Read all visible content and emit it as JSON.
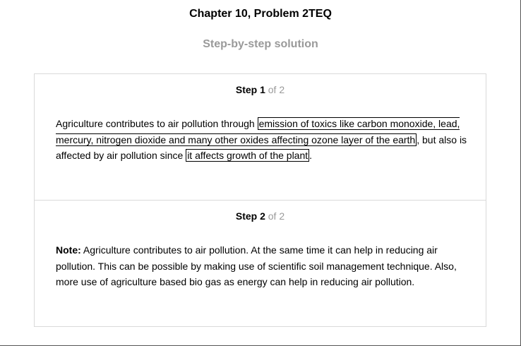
{
  "header": {
    "title": "Chapter 10, Problem 2TEQ",
    "subtitle": "Step-by-step solution"
  },
  "steps": [
    {
      "label": "Step 1",
      "of": "of 2",
      "text_before": "Agriculture contributes to air pollution through ",
      "highlight_1": "emission of toxics like carbon monoxide, lead, mercury, nitrogen dioxide and many other oxides affecting ozone layer of the earth",
      "text_middle": ", but also is affected by air pollution since ",
      "highlight_2": "it affects growth of the plant",
      "text_after": "."
    },
    {
      "label": "Step 2",
      "of": "of 2",
      "note_label": "Note:",
      "text": " Agriculture contributes to air pollution. At the same time it can help in reducing air pollution. This can be possible by making use of scientific soil management technique. Also, more use of agriculture based bio gas as energy can help in reducing air pollution."
    }
  ]
}
